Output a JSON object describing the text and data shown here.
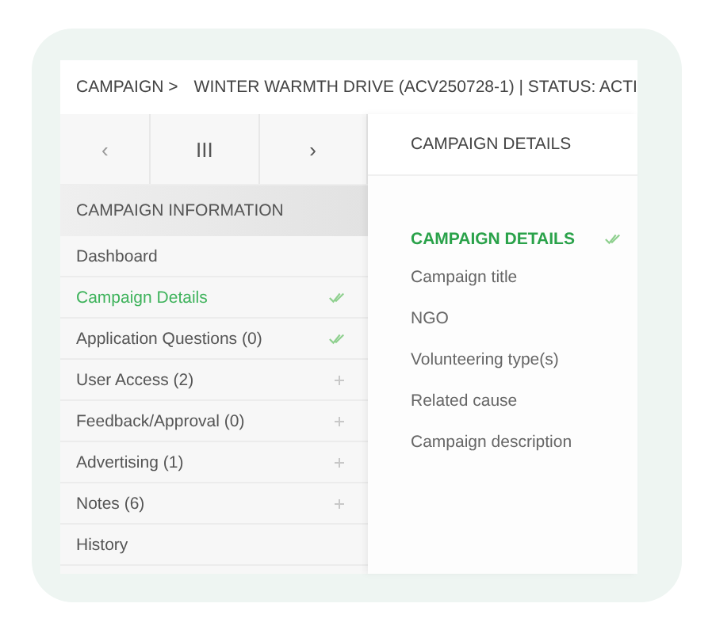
{
  "breadcrumb": {
    "root": "CAMPAIGN >",
    "title": "WINTER WARMTH DRIVE (ACV250728-1) | STATUS: ACTI"
  },
  "nav": {
    "prev": "‹",
    "grid": "III",
    "next": "›"
  },
  "sidebar": {
    "heading": "CAMPAIGN INFORMATION",
    "items": [
      {
        "label": "Dashboard",
        "selected": false,
        "kind": "plain"
      },
      {
        "label": "Campaign Details",
        "selected": true,
        "kind": "done"
      },
      {
        "label": "Application Questions (0)",
        "selected": false,
        "kind": "done"
      },
      {
        "label": "User Access (2)",
        "selected": false,
        "kind": "add"
      },
      {
        "label": "Feedback/Approval (0)",
        "selected": false,
        "kind": "add"
      },
      {
        "label": "Advertising (1)",
        "selected": false,
        "kind": "add"
      },
      {
        "label": "Notes (6)",
        "selected": false,
        "kind": "add"
      },
      {
        "label": "History",
        "selected": false,
        "kind": "plain"
      }
    ]
  },
  "content": {
    "header": "CAMPAIGN DETAILS",
    "section": {
      "title": "CAMPAIGN DETAILS",
      "done": true,
      "fields": [
        "Campaign title",
        "NGO",
        "Volunteering type(s)",
        "Related cause",
        "Campaign description"
      ]
    }
  }
}
